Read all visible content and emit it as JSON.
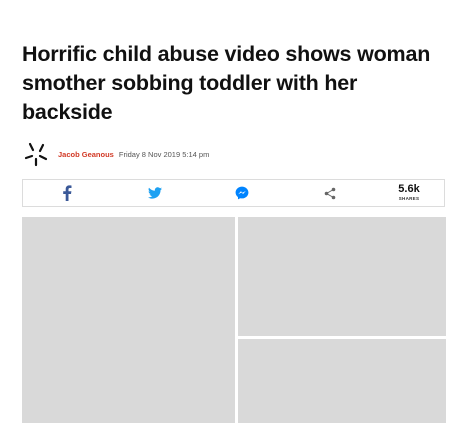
{
  "article": {
    "headline": "Horrific child abuse video shows woman smother sobbing toddler with her backside",
    "author": "Jacob Geanous",
    "date": "Friday 8 Nov 2019 5:14 pm"
  },
  "share_bar": {
    "icons": [
      "facebook-icon",
      "twitter-icon",
      "messenger-icon",
      "share-icon"
    ],
    "count": "5.6k",
    "count_label": "SHARES",
    "colors": {
      "facebook": "#3b5998",
      "twitter": "#1da1f2",
      "messenger": "#0084ff",
      "share": "#666666"
    }
  },
  "colors": {
    "author": "#d23a26"
  }
}
